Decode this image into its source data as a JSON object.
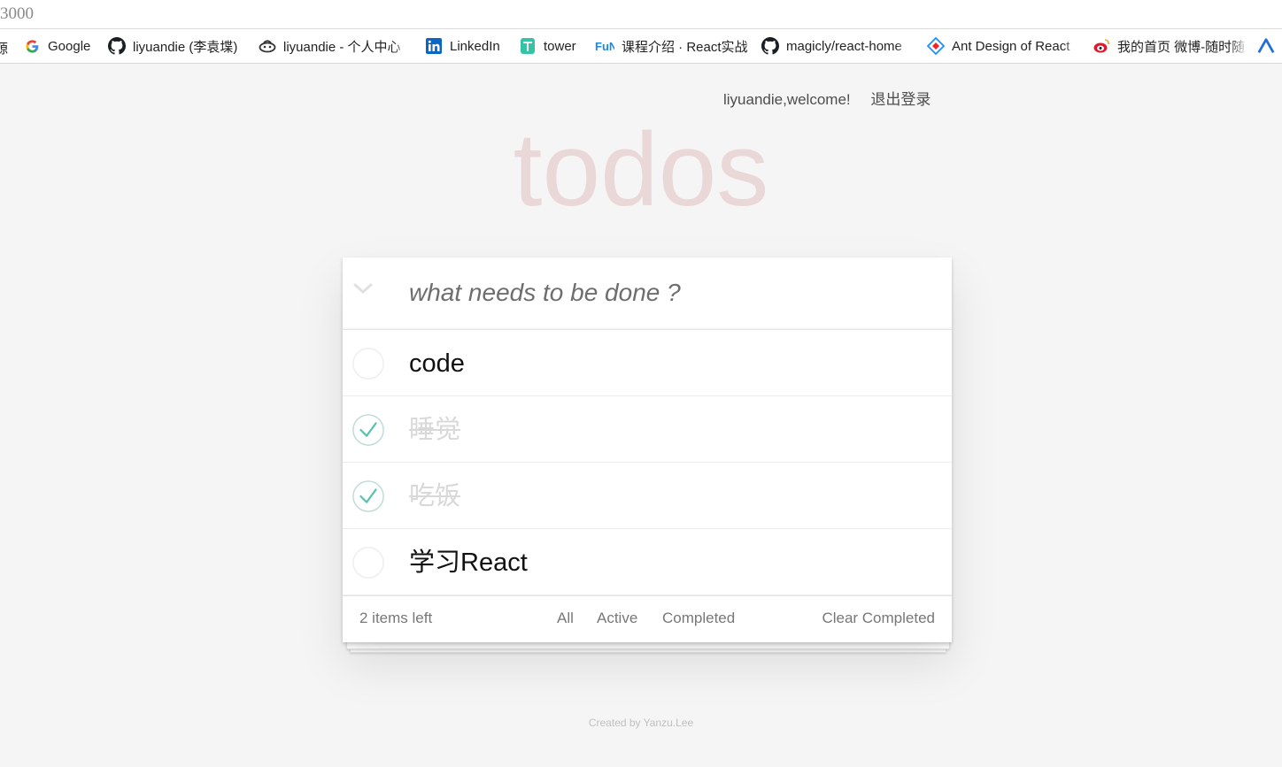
{
  "browser": {
    "address_text": "3000",
    "bookmark_cutoff": "源",
    "bookmarks": [
      {
        "label": "Google",
        "icon": "google-icon"
      },
      {
        "label": "liyuandie (李袁堞)",
        "icon": "github-icon"
      },
      {
        "label": "liyuandie - 个人中心",
        "icon": "segmentfault-icon"
      },
      {
        "label": "LinkedIn",
        "icon": "linkedin-icon"
      },
      {
        "label": "tower",
        "icon": "tower-icon"
      },
      {
        "label": "课程介绍 · React实战",
        "icon": "fun-icon"
      },
      {
        "label": "magicly/react-home",
        "icon": "github-icon"
      },
      {
        "label": "Ant Design of React",
        "icon": "antdesign-icon"
      },
      {
        "label": "我的首页 微博-随时随",
        "icon": "weibo-icon"
      }
    ]
  },
  "header": {
    "welcome": "liyuandie,welcome!",
    "logout": "退出登录"
  },
  "app": {
    "title": "todos",
    "input_placeholder": "what needs to be done ?",
    "input_value": ""
  },
  "todos": [
    {
      "text": "code",
      "completed": false
    },
    {
      "text": "睡觉",
      "completed": true
    },
    {
      "text": "吃饭",
      "completed": true
    },
    {
      "text": "学习React",
      "completed": false
    }
  ],
  "footer": {
    "items_left": "2 items left",
    "filters": [
      "All",
      "Active",
      "Completed"
    ],
    "clear_completed": "Clear Completed"
  },
  "credit": "Created by Yanzu.Lee",
  "colors": {
    "background": "#f5f5f5",
    "title": "#af2f2f",
    "check": "#5dc2af",
    "completed_text": "#d9d9d9"
  }
}
